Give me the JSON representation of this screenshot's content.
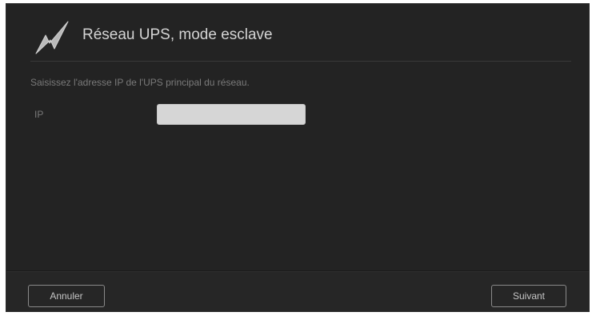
{
  "dialog": {
    "title": "Réseau UPS, mode esclave",
    "logo_icon": "lightning-bolt-icon",
    "instruction": "Saisissez l'adresse IP de l'UPS principal du réseau.",
    "ip_field": {
      "label": "IP",
      "value": "",
      "placeholder": ""
    }
  },
  "footer": {
    "cancel_label": "Annuler",
    "next_label": "Suivant"
  },
  "colors": {
    "background": "#232323",
    "title_text": "#d4d4d4",
    "muted_text": "#7a7a7a",
    "input_background": "#d6d6d6",
    "button_border": "#8a8a8a"
  }
}
